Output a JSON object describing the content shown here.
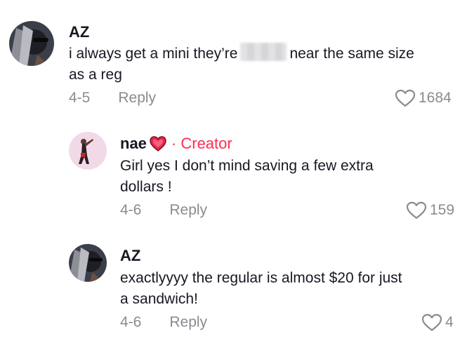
{
  "comments": [
    {
      "username": "AZ",
      "text_before": "i always get a mini they’re",
      "text_after": "near the same size",
      "text_line2": "as a reg",
      "date": "4-5",
      "reply_label": "Reply",
      "likes": "1684"
    },
    {
      "username": "nae",
      "username_emoji": "heart",
      "creator_label": "· Creator",
      "text_line1": "Girl yes I don’t mind saving a few extra",
      "text_line2": "dollars !",
      "date": "4-6",
      "reply_label": "Reply",
      "likes": "159"
    },
    {
      "username": "AZ",
      "text_line1": "exactlyyyy the regular is almost $20 for just",
      "text_line2": "a sandwich!",
      "date": "4-6",
      "reply_label": "Reply",
      "likes": "4"
    }
  ],
  "colors": {
    "accent": "#fe2c55",
    "meta": "#8a8b91",
    "text": "#161823"
  }
}
